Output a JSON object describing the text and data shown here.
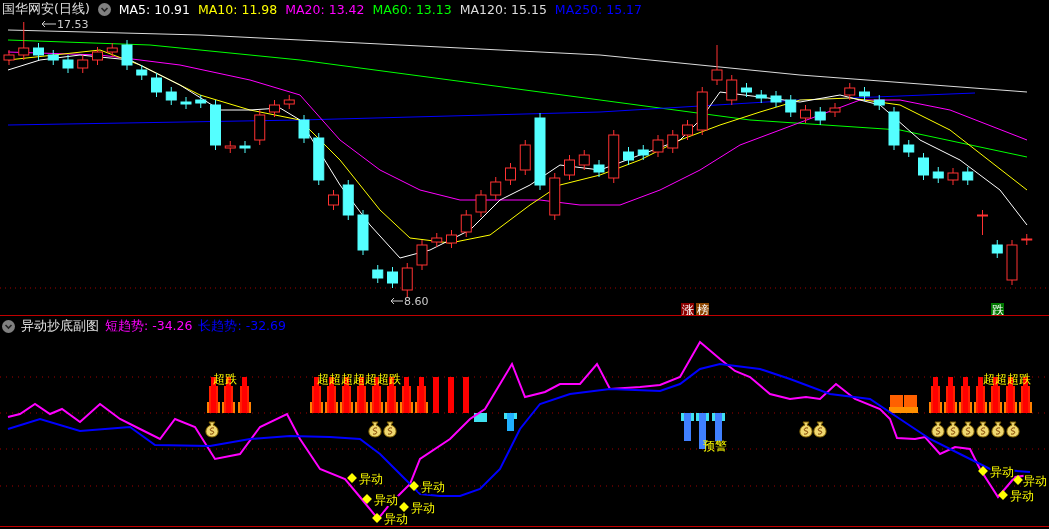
{
  "header": {
    "stock_name": "国华网安(日线)",
    "ma_readings": [
      {
        "label": "MA5: 10.91",
        "color": "#ffffff"
      },
      {
        "label": "MA10: 11.98",
        "color": "#ffff00"
      },
      {
        "label": "MA20: 13.42",
        "color": "#ff00ff"
      },
      {
        "label": "MA60: 13.13",
        "color": "#00ff00"
      },
      {
        "label": "MA120: 15.15",
        "color": "#dcdcdc"
      },
      {
        "label": "MA250: 15.17",
        "color": "#0000ff"
      }
    ]
  },
  "main_chart": {
    "high_label": "17.53",
    "low_label": "8.60",
    "badges": [
      {
        "text": "涨",
        "color": "#8b0000"
      },
      {
        "text": "榜",
        "color": "#8b4500"
      },
      {
        "text": "跌",
        "color": "#007800"
      }
    ]
  },
  "indicator": {
    "title": "异动抄底副图",
    "readings": [
      {
        "label": "短趋势: -34.26",
        "color": "#ff00ff"
      },
      {
        "label": "长趋势: -32.69",
        "color": "#0000ff"
      }
    ],
    "oversold_labels": [
      "超跌",
      "超超超超超超跌",
      "超超超跌"
    ],
    "warning_label": "预警",
    "move_labels": [
      "异动",
      "异动",
      "异动",
      "异动",
      "异动",
      "异动",
      "异动",
      "异动"
    ]
  }
}
